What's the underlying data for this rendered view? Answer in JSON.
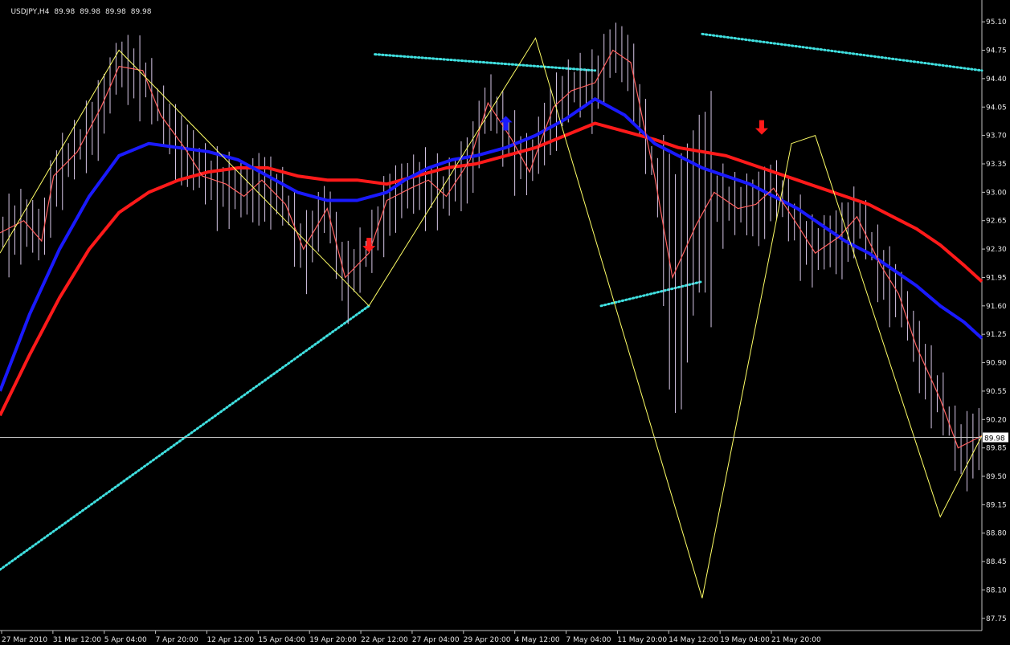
{
  "header": {
    "symbol": "USDJPY,H4",
    "open": "89.98",
    "high": "89.98",
    "low": "89.98",
    "close": "89.98"
  },
  "colors": {
    "background": "#000000",
    "axis": "#c0c0c0",
    "text": "#e6e6e6",
    "bars": "#d8c8e8",
    "price_line": "#ff6060",
    "ma_fast": "#1a1aff",
    "ma_slow": "#ff1a1a",
    "zigzag": "#ffff66",
    "dots": "#40e0e0",
    "arrow_up": "#1a1aff",
    "arrow_down": "#ff1a1a"
  },
  "chart_data": {
    "type": "line",
    "title": "",
    "xlabel": "",
    "ylabel": "",
    "ylim": [
      87.6,
      95.25
    ],
    "y_ticks": [
      "95.10",
      "94.75",
      "94.40",
      "94.05",
      "93.70",
      "93.35",
      "93.00",
      "92.65",
      "92.30",
      "91.95",
      "91.60",
      "91.25",
      "90.90",
      "90.55",
      "90.20",
      "89.85",
      "89.50",
      "89.15",
      "88.80",
      "88.45",
      "88.10",
      "87.75"
    ],
    "current_price": "89.98",
    "x_ticks": [
      "27 Mar 2010",
      "31 Mar 12:00",
      "5 Apr 04:00",
      "7 Apr 20:00",
      "12 Apr 12:00",
      "15 Apr 04:00",
      "19 Apr 20:00",
      "22 Apr 12:00",
      "27 Apr 04:00",
      "29 Apr 20:00",
      "4 May 12:00",
      "7 May 04:00",
      "11 May 20:00",
      "14 May 12:00",
      "19 May 04:00",
      "21 May 20:00"
    ],
    "x_count": 165,
    "series": [
      {
        "role": "price",
        "x": [
          0,
          4,
          7,
          9,
          13,
          17,
          20,
          24,
          27,
          31,
          34,
          38,
          41,
          44,
          48,
          51,
          55,
          58,
          62,
          65,
          69,
          72,
          75,
          79,
          82,
          86,
          89,
          93,
          96,
          100,
          103,
          106,
          110,
          113,
          117,
          120,
          124,
          127,
          130,
          134,
          137,
          141,
          144,
          148,
          151,
          154,
          158,
          161,
          165
        ],
        "values": [
          92.5,
          92.65,
          92.4,
          93.2,
          93.5,
          94.05,
          94.55,
          94.5,
          93.95,
          93.55,
          93.2,
          93.1,
          92.95,
          93.15,
          92.85,
          92.3,
          92.8,
          91.95,
          92.25,
          92.9,
          93.05,
          93.15,
          92.95,
          93.4,
          94.1,
          93.65,
          93.25,
          94.05,
          94.25,
          94.35,
          94.75,
          94.6,
          93.2,
          91.95,
          92.6,
          93.0,
          92.8,
          92.85,
          93.05,
          92.6,
          92.25,
          92.45,
          92.7,
          92.1,
          91.75,
          91.1,
          90.45,
          89.85,
          90.0
        ]
      },
      {
        "role": "ma_fast",
        "x": [
          0,
          5,
          10,
          15,
          20,
          25,
          30,
          35,
          40,
          45,
          50,
          55,
          60,
          65,
          68,
          72,
          76,
          80,
          85,
          90,
          95,
          100,
          105,
          110,
          114,
          118,
          122,
          126,
          130,
          134,
          138,
          142,
          146,
          150,
          154,
          158,
          162,
          165
        ],
        "values": [
          90.55,
          91.5,
          92.3,
          92.95,
          93.45,
          93.6,
          93.55,
          93.5,
          93.4,
          93.2,
          93.0,
          92.9,
          92.9,
          93.0,
          93.15,
          93.3,
          93.4,
          93.45,
          93.55,
          93.7,
          93.9,
          94.15,
          93.95,
          93.6,
          93.45,
          93.3,
          93.2,
          93.1,
          92.95,
          92.8,
          92.6,
          92.4,
          92.25,
          92.05,
          91.85,
          91.6,
          91.4,
          91.2
        ]
      },
      {
        "role": "ma_slow",
        "x": [
          0,
          5,
          10,
          15,
          20,
          25,
          30,
          35,
          40,
          45,
          50,
          55,
          60,
          65,
          70,
          75,
          80,
          85,
          90,
          95,
          100,
          105,
          110,
          114,
          118,
          122,
          126,
          130,
          134,
          138,
          142,
          146,
          150,
          154,
          158,
          162,
          165
        ],
        "values": [
          90.25,
          91.0,
          91.7,
          92.3,
          92.75,
          93.0,
          93.15,
          93.25,
          93.3,
          93.3,
          93.2,
          93.15,
          93.15,
          93.1,
          93.2,
          93.3,
          93.35,
          93.45,
          93.55,
          93.7,
          93.85,
          93.75,
          93.65,
          93.55,
          93.5,
          93.45,
          93.35,
          93.25,
          93.15,
          93.05,
          92.95,
          92.85,
          92.7,
          92.55,
          92.35,
          92.1,
          91.9
        ]
      },
      {
        "role": "zigzag",
        "x": [
          0,
          20,
          62,
          90,
          118,
          133,
          137,
          158,
          165
        ],
        "values": [
          92.25,
          94.75,
          91.6,
          94.9,
          88.0,
          93.6,
          93.7,
          89.0,
          90.0
        ]
      },
      {
        "role": "channel_dots",
        "segments": [
          {
            "x": [
              0,
              62
            ],
            "values": [
              88.35,
              91.6
            ]
          },
          {
            "x": [
              63,
              100
            ],
            "values": [
              94.7,
              94.5
            ]
          },
          {
            "x": [
              118,
              165
            ],
            "values": [
              94.95,
              94.5
            ]
          },
          {
            "x": [
              101,
              118
            ],
            "values": [
              91.6,
              91.9
            ]
          }
        ]
      }
    ],
    "arrows": [
      {
        "dir": "down",
        "x": 62,
        "value": 92.3
      },
      {
        "dir": "up",
        "x": 85,
        "value": 93.9
      },
      {
        "dir": "down",
        "x": 128,
        "value": 93.75
      }
    ]
  }
}
